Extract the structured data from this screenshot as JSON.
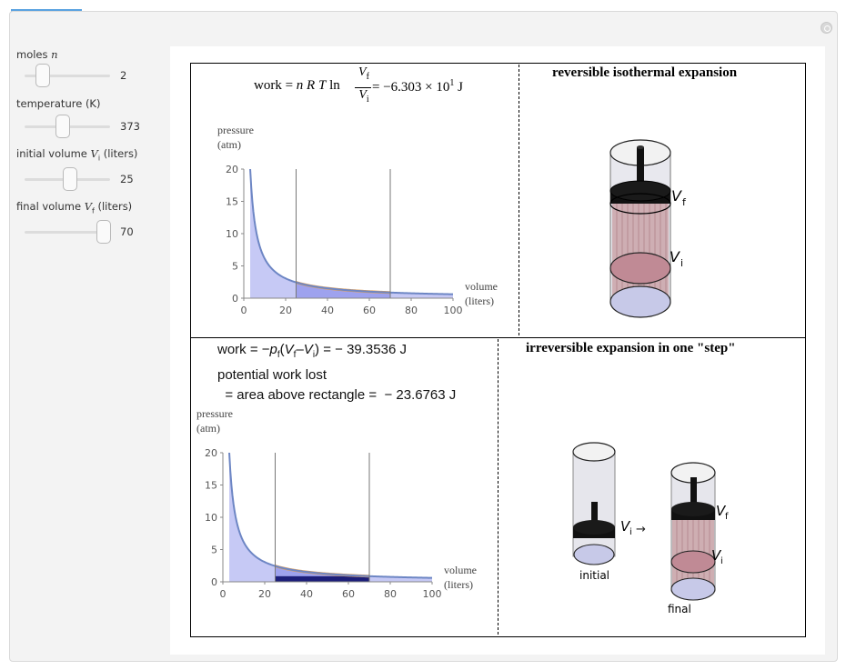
{
  "controls": [
    {
      "label_text": "moles ",
      "label_var": "n",
      "label_sub": "",
      "label_rest": "",
      "value": "2",
      "fraction": 0.21
    },
    {
      "label_text": "temperature (K)",
      "label_var": "",
      "label_sub": "",
      "label_rest": "",
      "value": "373",
      "fraction": 0.45
    },
    {
      "label_text": "initial volume ",
      "label_var": "V",
      "label_sub": "i",
      "label_rest": " (liters)",
      "value": "25",
      "fraction": 0.53
    },
    {
      "label_text": "final volume ",
      "label_var": "V",
      "label_sub": "f",
      "label_rest": " (liters)",
      "value": "70",
      "fraction": 0.93
    }
  ],
  "top": {
    "title": "reversible isothermal expansion",
    "formula_lhs": "work = ",
    "formula_vars": "n R T",
    "formula_ln": " ln ",
    "frac_num": "V",
    "frac_num_sub": "f",
    "frac_den": "V",
    "frac_den_sub": "i",
    "formula_result": " = −6.303 × 10",
    "formula_exp": "1",
    "formula_unit": " J",
    "ylabel_1": "pressure",
    "ylabel_2": "(atm)",
    "xlabel_1": "volume",
    "xlabel_2": "(liters)",
    "label_vf": "V",
    "label_vf_sub": "f",
    "label_vi": "V",
    "label_vi_sub": "i"
  },
  "bottom": {
    "title": "irreversible expansion in one \"step\"",
    "line1_pre": "work = −",
    "line1_p": "p",
    "line1_p_sub": "f",
    "line1_mid": "(",
    "line1_vf": "V",
    "line1_vf_sub": "f",
    "line1_minus": "–",
    "line1_vi": "V",
    "line1_vi_sub": "i",
    "line1_post": ") =  − 39.3536 J",
    "line2": "potential work lost",
    "line3": "  = area above rectangle =  − 23.6763 J",
    "ylabel_1": "pressure",
    "ylabel_2": "(atm)",
    "xlabel_1": "volume",
    "xlabel_2": "(liters)",
    "label_initial": "initial",
    "label_final": "final",
    "label_vi": "V",
    "label_vi_sub": "i",
    "label_vf": "V",
    "label_vf_sub": "f",
    "label_vf2": "V",
    "label_vf2_sub": "f",
    "label_vi2": "V",
    "label_vi2_sub": "i"
  },
  "chart_data": [
    {
      "type": "area",
      "title": "",
      "xlabel": "volume (liters)",
      "ylabel": "pressure (atm)",
      "xlim": [
        0,
        100
      ],
      "ylim": [
        0,
        20
      ],
      "x_ticks": [
        "0",
        "20",
        "40",
        "60",
        "80",
        "100"
      ],
      "y_ticks": [
        "0",
        "5",
        "10",
        "15",
        "20"
      ],
      "series": [
        {
          "values_formula_nRT": 61.22,
          "x": [
            2,
            3,
            4,
            5,
            6,
            8,
            10,
            15,
            20,
            25,
            30,
            40,
            50,
            60,
            70,
            80,
            90,
            100
          ],
          "y": [
            30.6,
            20.4,
            15.3,
            12.24,
            10.2,
            7.65,
            6.12,
            4.08,
            3.06,
            2.45,
            2.04,
            1.53,
            1.22,
            1.02,
            0.87,
            0.77,
            0.68,
            0.61
          ]
        }
      ],
      "vlines": [
        25,
        70
      ],
      "shaded_between": [
        25,
        70
      ]
    },
    {
      "type": "area",
      "title": "",
      "xlabel": "volume (liters)",
      "ylabel": "pressure (atm)",
      "xlim": [
        0,
        100
      ],
      "ylim": [
        0,
        20
      ],
      "x_ticks": [
        "0",
        "20",
        "40",
        "60",
        "80",
        "100"
      ],
      "y_ticks": [
        "0",
        "5",
        "10",
        "15",
        "20"
      ],
      "series": [
        {
          "x": [
            2,
            3,
            4,
            5,
            6,
            8,
            10,
            15,
            20,
            25,
            30,
            40,
            50,
            60,
            70,
            80,
            90,
            100
          ],
          "y": [
            30.6,
            20.4,
            15.3,
            12.24,
            10.2,
            7.65,
            6.12,
            4.08,
            3.06,
            2.45,
            2.04,
            1.53,
            1.22,
            1.02,
            0.87,
            0.77,
            0.68,
            0.61
          ]
        }
      ],
      "vlines": [
        25,
        70
      ],
      "rectangle": {
        "x_from": 25,
        "x_to": 70,
        "p_final": 0.87
      }
    }
  ],
  "colors": {
    "curve": "#6d86c4",
    "fill": "#c6c9f5",
    "fill_dark": "#9ea2ee",
    "orange": "#e0a05a",
    "rect": "#1d1f7a"
  }
}
